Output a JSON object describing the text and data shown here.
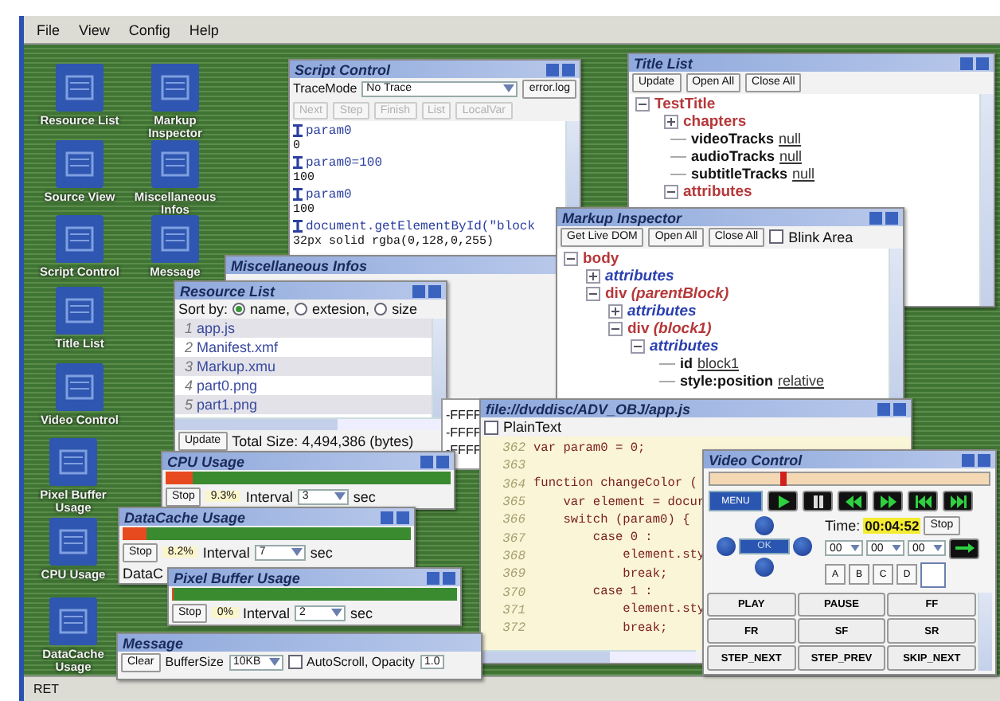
{
  "menu": [
    "File",
    "View",
    "Config",
    "Help"
  ],
  "desktop_icons": [
    {
      "label": "Resource List"
    },
    {
      "label": "Markup Inspector"
    },
    {
      "label": "Source View"
    },
    {
      "label": "Miscellaneous Infos"
    },
    {
      "label": "Script Control"
    },
    {
      "label": "Message"
    },
    {
      "label": "Title List"
    },
    {
      "label": "Video Control"
    },
    {
      "label": "Pixel Buffer Usage"
    },
    {
      "label": "CPU Usage"
    },
    {
      "label": "DataCache Usage"
    }
  ],
  "script_control": {
    "title": "Script Control",
    "trace_label": "TraceMode",
    "trace_value": "No Trace",
    "log_button": "error.log",
    "buttons": [
      {
        "label": "Next",
        "disabled": true
      },
      {
        "label": "Step",
        "disabled": true
      },
      {
        "label": "Finish",
        "disabled": true
      },
      {
        "label": "List",
        "disabled": true
      },
      {
        "label": "LocalVar",
        "disabled": true
      }
    ],
    "console": [
      {
        "kind": "input",
        "text": "param0"
      },
      {
        "kind": "output",
        "text": "0"
      },
      {
        "kind": "input",
        "text": "param0=100"
      },
      {
        "kind": "output",
        "text": "100"
      },
      {
        "kind": "input",
        "text": "param0"
      },
      {
        "kind": "output",
        "text": "100"
      },
      {
        "kind": "input",
        "text": "document.getElementById(\"block"
      },
      {
        "kind": "output",
        "text": "32px solid rgba(0,128,0,255)"
      }
    ]
  },
  "title_list": {
    "title": "Title List",
    "buttons": [
      "Update",
      "Open All",
      "Close All"
    ],
    "tree": [
      {
        "kind": "element",
        "label": "TestTitle",
        "expanded": true,
        "children": [
          {
            "kind": "element",
            "label": "chapters",
            "expanded": false
          },
          {
            "kind": "property",
            "name": "videoTracks",
            "value": "null"
          },
          {
            "kind": "property",
            "name": "audioTracks",
            "value": "null"
          },
          {
            "kind": "property",
            "name": "subtitleTracks",
            "value": "null"
          },
          {
            "kind": "element",
            "label": "attributes",
            "expanded": true
          }
        ]
      }
    ]
  },
  "misc_infos": {
    "title": "Miscellaneous Infos"
  },
  "markup_inspector": {
    "title": "Markup Inspector",
    "buttons": [
      "Get Live DOM",
      "Open All",
      "Close All"
    ],
    "blink_area": {
      "label": "Blink Area",
      "checked": false
    },
    "tree": [
      {
        "kind": "element",
        "label": "body",
        "expanded": true,
        "children": [
          {
            "kind": "attributes",
            "label": "attributes",
            "expanded": false
          },
          {
            "kind": "element",
            "label": "div *(parentBlock)*",
            "expanded": true,
            "children": [
              {
                "kind": "attributes",
                "label": "attributes",
                "expanded": false
              },
              {
                "kind": "element",
                "label": "div *(block1)*",
                "expanded": true,
                "children": [
                  {
                    "kind": "attributes",
                    "label": "attributes",
                    "expanded": true,
                    "children": [
                      {
                        "kind": "property",
                        "name": "id",
                        "value": "block1"
                      },
                      {
                        "kind": "property",
                        "name": "style:position",
                        "value": "relative"
                      }
                    ]
                  }
                ]
              }
            ]
          }
        ]
      }
    ]
  },
  "resource_list": {
    "title": "Resource List",
    "sort_label": "Sort by:",
    "sort_options": [
      {
        "label": "name,",
        "selected": true
      },
      {
        "label": "extesion,",
        "selected": false
      },
      {
        "label": "size",
        "selected": false
      }
    ],
    "items": [
      {
        "number": "1",
        "name": "app.js"
      },
      {
        "number": "2",
        "name": "Manifest.xmf"
      },
      {
        "number": "3",
        "name": "Markup.xmu"
      },
      {
        "number": "4",
        "name": "part0.png"
      },
      {
        "number": "5",
        "name": "part1.png"
      }
    ],
    "update_button": "Update",
    "total": "Total Size: 4,494,386 (bytes)"
  },
  "memory_lines": [
    "-FFFF",
    "-FFFF",
    "-FFFF"
  ],
  "source_view": {
    "title": "file://dvddisc/ADV_OBJ/app.js",
    "plain_text": {
      "label": "PlainText",
      "checked": false
    },
    "lines": [
      {
        "number": "362",
        "code": "var param0 = 0;"
      },
      {
        "number": "363"
      },
      {
        "number": "364",
        "code": "function changeColor ("
      },
      {
        "number": "365",
        "code": "    var element = docur"
      },
      {
        "number": "366",
        "code": "    switch (param0) {"
      },
      {
        "number": "367",
        "code": "        case 0 :"
      },
      {
        "number": "368",
        "code": "            element.sty"
      },
      {
        "number": "369",
        "code": "            break;"
      },
      {
        "number": "370",
        "code": "        case 1 :"
      },
      {
        "number": "371",
        "code": "            element.sty"
      },
      {
        "number": "372",
        "code": "            break;"
      }
    ]
  },
  "usage_windows": [
    {
      "title": "CPU Usage",
      "level": 0.093,
      "reading": "9.3%",
      "interval_label": "Interval",
      "interval": "3",
      "unit": "sec",
      "stop": "Stop"
    },
    {
      "title": "DataCache Usage",
      "level": 0.082,
      "reading": "8.2%",
      "interval_label": "Interval",
      "interval": "7",
      "unit": "sec",
      "stop": "Stop",
      "extra": "DataC"
    },
    {
      "title": "Pixel Buffer Usage",
      "level": 0,
      "reading": "0%",
      "interval_label": "Interval",
      "interval": "2",
      "unit": "sec",
      "stop": "Stop"
    }
  ],
  "message": {
    "title": "Message",
    "clear": "Clear",
    "buffer_label": "BufferSize",
    "buffer": "10KB",
    "autoscroll": {
      "label": "AutoScroll, Opacity",
      "checked": false
    },
    "opacity": "1.0"
  },
  "video_control": {
    "title": "Video Control",
    "position": {
      "level": 0.25
    },
    "transport": [
      {
        "kind": "label",
        "text": "MENU"
      },
      {
        "kind": "play"
      },
      {
        "kind": "pause"
      },
      {
        "kind": "rewind"
      },
      {
        "kind": "forward"
      },
      {
        "kind": "skip_back"
      },
      {
        "kind": "skip_forward"
      }
    ],
    "ok": "OK",
    "time_label": "Time:",
    "time": "00:04:52",
    "stop": "Stop",
    "selects": [
      "00",
      "00",
      "00"
    ],
    "letters": [
      "A",
      "B",
      "C",
      "D"
    ],
    "commands": [
      "PLAY",
      "PAUSE",
      "FF",
      "FR",
      "SF",
      "SR",
      "STEP_NEXT",
      "STEP_PREV",
      "SKIP_NEXT"
    ]
  },
  "status_bar": {
    "text": "RET"
  }
}
